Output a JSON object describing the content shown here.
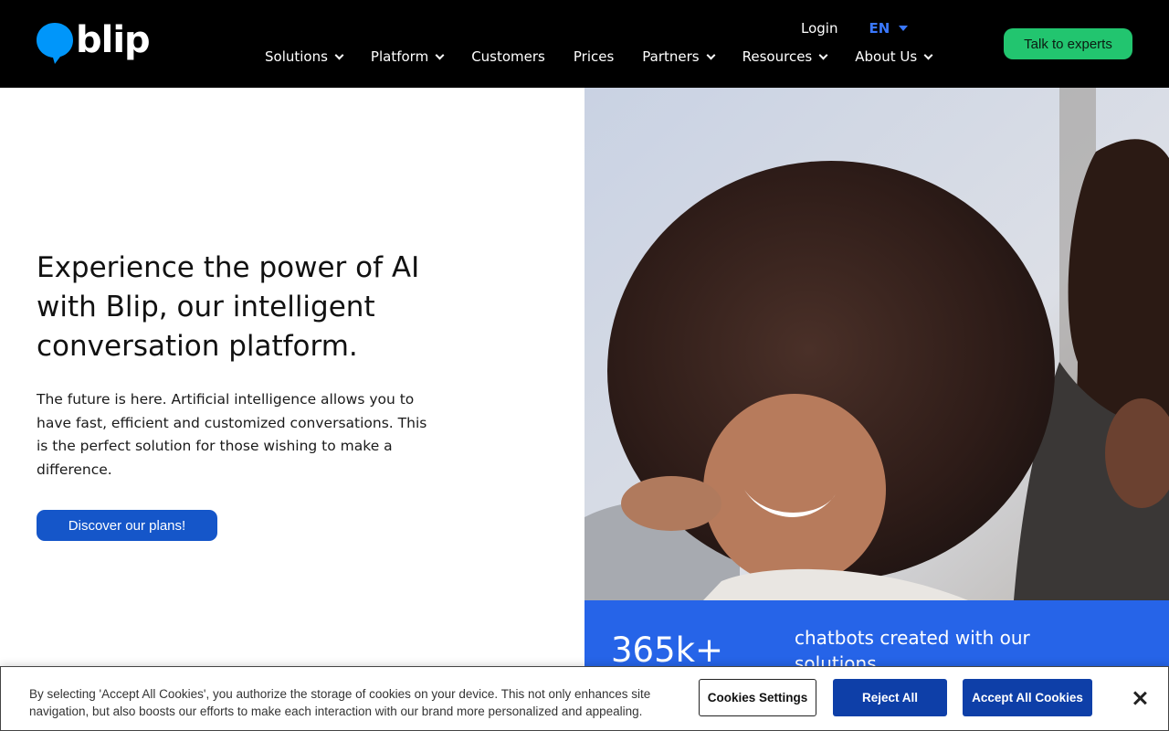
{
  "brand": {
    "name": "blip",
    "accent": "#0096FA",
    "cta_color": "#22C56F"
  },
  "top": {
    "login": "Login",
    "language": "EN"
  },
  "nav": {
    "items": [
      {
        "label": "Solutions",
        "dropdown": true
      },
      {
        "label": "Platform",
        "dropdown": true
      },
      {
        "label": "Customers",
        "dropdown": false
      },
      {
        "label": "Prices",
        "dropdown": false
      },
      {
        "label": "Partners",
        "dropdown": true
      },
      {
        "label": "Resources",
        "dropdown": true
      },
      {
        "label": "About Us",
        "dropdown": true
      }
    ],
    "cta": "Talk to experts"
  },
  "hero": {
    "title": "Experience the power of AI with Blip, our intelligent conversation platform.",
    "description": "The future is here. Artificial intelligence allows you to have fast, efficient and customized conversations. This is the perfect solution for those wishing to make a difference.",
    "button": "Discover our plans!"
  },
  "stats": {
    "value": "365k+",
    "label": "chatbots created with our solutions"
  },
  "cookie": {
    "text": "By selecting 'Accept All Cookies', you authorize the storage of cookies on your device. This not only enhances site navigation, but also boosts our efforts to make each interaction with our brand more personalized and appealing.",
    "settings": "Cookies Settings",
    "reject": "Reject All",
    "accept": "Accept All Cookies"
  }
}
